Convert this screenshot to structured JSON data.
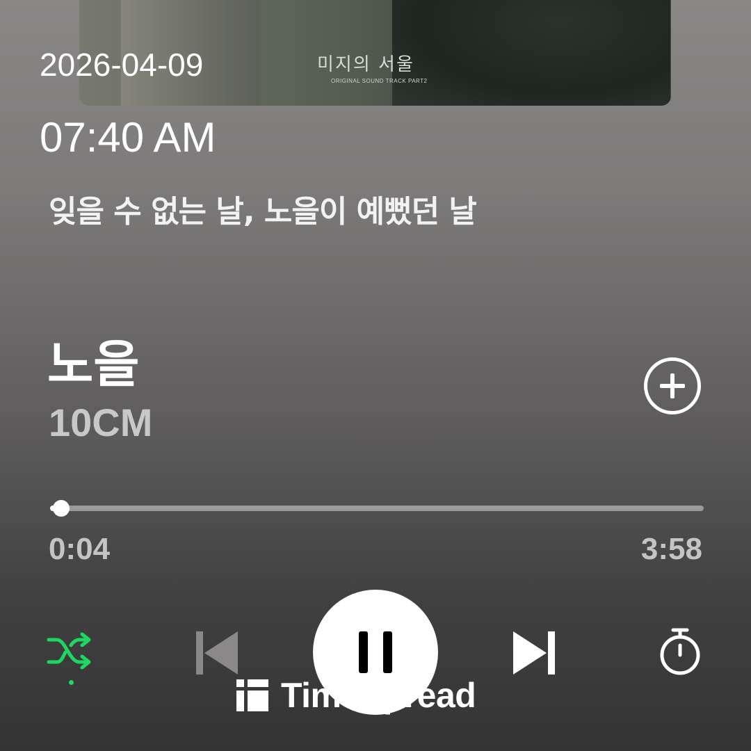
{
  "album_art": {
    "title": "미지의 서울",
    "subtitle": "ORIGINAL SOUND TRACK PART2"
  },
  "overlay": {
    "date": "2026-04-09",
    "time": "07:40 AM"
  },
  "lyrics": {
    "current_line": "잊을 수 없는 날, 노을이 예뻤던 날"
  },
  "track": {
    "title": "노을",
    "artist": "10CM"
  },
  "playback": {
    "elapsed": "0:04",
    "duration": "3:58",
    "progress_fraction": 0.0168,
    "is_playing": true,
    "shuffle_enabled": true
  },
  "colors": {
    "accent_green": "#1ed760",
    "progress_track": "#9b9999",
    "disabled_control": "#8a8888"
  },
  "icons": {
    "add": "plus-circle-icon",
    "shuffle": "shuffle-icon",
    "previous": "skip-previous-icon",
    "pause": "pause-icon",
    "next": "skip-next-icon",
    "timer": "sleep-timer-icon"
  },
  "watermark": {
    "text": "TimeSpread"
  }
}
